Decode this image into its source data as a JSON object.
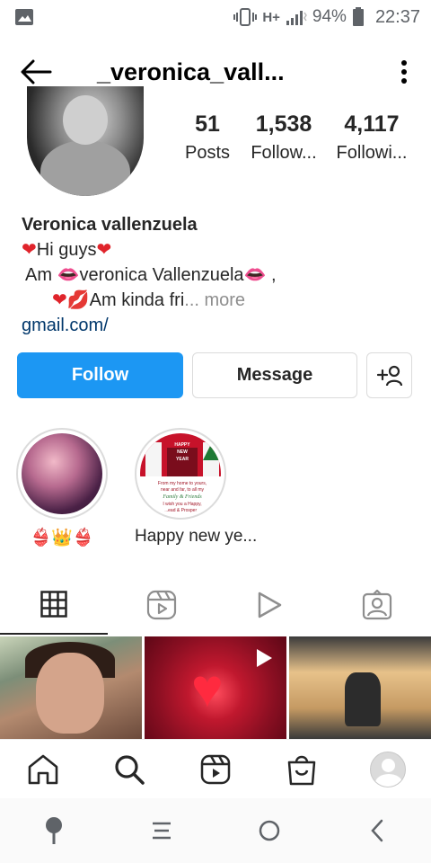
{
  "status_bar": {
    "network": "H+",
    "battery": "94%",
    "time": "22:37"
  },
  "header": {
    "username": "_veronica_vall..."
  },
  "profile": {
    "stats": [
      {
        "value": "51",
        "label": "Posts"
      },
      {
        "value": "1,538",
        "label": "Follow..."
      },
      {
        "value": "4,117",
        "label": "Followi..."
      }
    ],
    "bio": {
      "name": "Veronica vallenzuela",
      "line1": "Hi guys",
      "line2": "Am ",
      "line2_name": "veronica Vallenzuela",
      "line2_end": " ,",
      "line3": "Am kinda fri",
      "more": "... more",
      "link": "gmail.com/"
    }
  },
  "buttons": {
    "follow": "Follow",
    "message": "Message"
  },
  "highlights": [
    {
      "label": "👙👑👙"
    },
    {
      "label": "Happy new ye..."
    }
  ],
  "highlight_card": {
    "title1": "HAPPY",
    "title2": "NEW",
    "title3": "YEAR",
    "msg1": "From my home to yours,",
    "msg2": "near and far, to all my",
    "msg3": "Family & Friends",
    "msg4": "I wish you a Happy,",
    "msg5": "...ead & Prosper..."
  },
  "tabs": [
    {
      "icon": "grid-icon",
      "active": true
    },
    {
      "icon": "reels-icon",
      "active": false
    },
    {
      "icon": "video-play-icon",
      "active": false
    },
    {
      "icon": "tagged-icon",
      "active": false
    }
  ],
  "bottom_nav": [
    "home-icon",
    "search-icon",
    "reels-icon",
    "shop-icon",
    "profile-avatar"
  ],
  "system_nav": [
    "assistant-icon",
    "recents-icon",
    "home-circle-icon",
    "back-chevron-icon"
  ],
  "colors": {
    "follow_button": "#1c97f3",
    "link": "#00376b",
    "heart": "#e0242b",
    "text": "#262626",
    "muted": "#8e8e8e"
  }
}
